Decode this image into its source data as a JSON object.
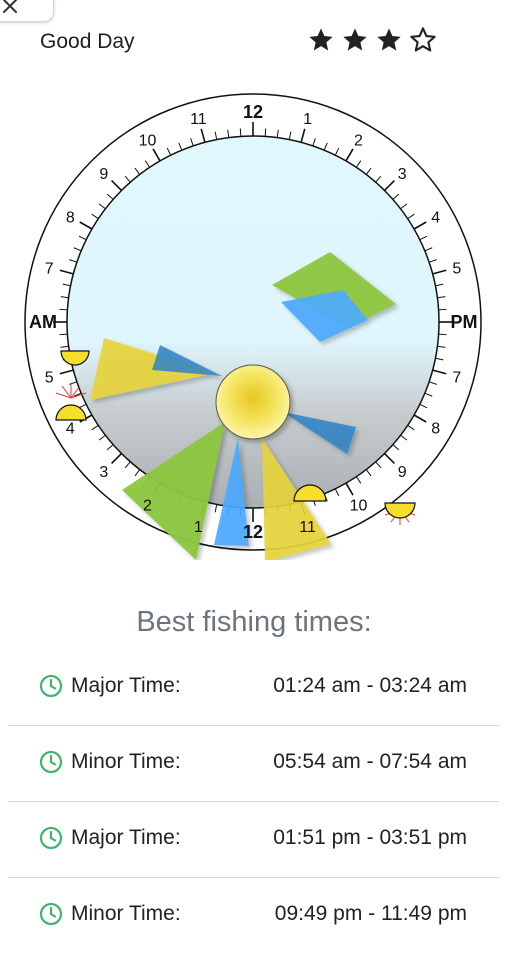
{
  "header": {
    "rating_label": "Good Day",
    "rating": {
      "filled": 3,
      "total": 4
    },
    "close_icon": "close-icon"
  },
  "dial": {
    "am_label": "AM",
    "pm_label": "PM",
    "top_label": "12",
    "bottom_label": "12",
    "am_hours": [
      "1",
      "2",
      "3",
      "4",
      "5",
      "7",
      "8",
      "9",
      "10",
      "11"
    ],
    "pm_hours": [
      "1",
      "2",
      "3",
      "4",
      "5",
      "7",
      "8",
      "9",
      "10",
      "11"
    ],
    "colors": {
      "major": "#7fbf1f",
      "minor": "#3aa0ff",
      "sun": "#f5e23a",
      "face_top": "#dff6fc",
      "face_bottom": "#b7bcbf"
    }
  },
  "section_title": "Best fishing times:",
  "times": [
    {
      "label": "Major Time:",
      "value": "01:24 am - 03:24 am",
      "icon": "clock-icon"
    },
    {
      "label": "Minor Time:",
      "value": "05:54 am - 07:54 am",
      "icon": "clock-icon"
    },
    {
      "label": "Major Time:",
      "value": "01:51 pm - 03:51 pm",
      "icon": "clock-icon"
    },
    {
      "label": "Minor Time:",
      "value": "09:49 pm - 11:49 pm",
      "icon": "clock-icon"
    }
  ]
}
